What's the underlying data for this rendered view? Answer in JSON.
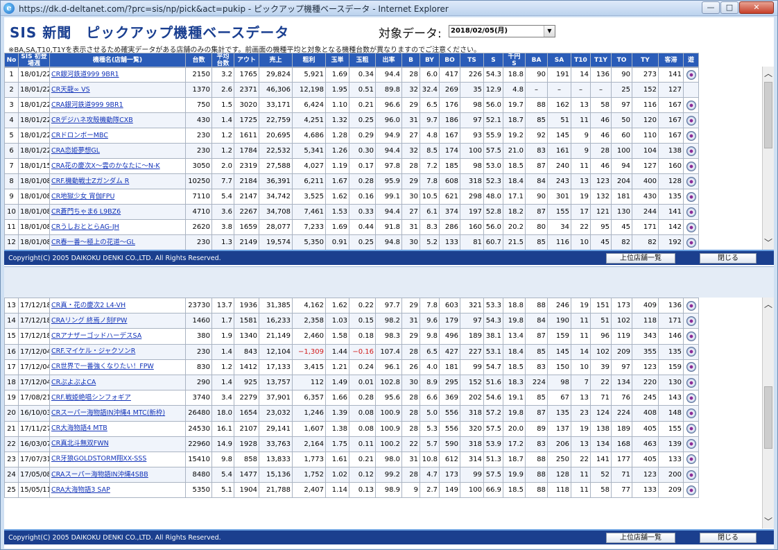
{
  "window": {
    "title": "https://dk.d-deltanet.com/?prc=sis/np/pick&act=pukip - ピックアップ機種ベースデータ - Internet Explorer",
    "min_glyph": "—",
    "max_glyph": "□",
    "close_glyph": "✕",
    "ie_glyph": "e"
  },
  "header": {
    "title": "SIS 新聞　ピックアップ機種ベースデータ",
    "target_label": "対象データ:",
    "date_value": "2018/02/05(月)",
    "note": "※BA,SA,T10,T1Yを表示させるため確実データがある店舗のみの集計です。前画面の機種平均と対象となる機種台数が異なりますのでご注意ください。"
  },
  "columns": [
    "No",
    "SIS 初登場週",
    "機種名(店舗一覧)",
    "台数",
    "平均 台数",
    "アウト",
    "売上",
    "粗利",
    "玉単",
    "玉粗",
    "出率",
    "B",
    "BY",
    "BO",
    "TS",
    "S",
    "千円 S",
    "BA",
    "SA",
    "T10",
    "T1Y",
    "TO",
    "TY",
    "客滞",
    "遊"
  ],
  "rows": [
    [
      "1",
      "18/01/22",
      "CR銀河鉄道999 9BR1",
      "2150",
      "3.2",
      "1765",
      "29,824",
      "5,921",
      "1.69",
      "0.34",
      "94.4",
      "28",
      "6.0",
      "417",
      "226",
      "54.3",
      "18.8",
      "90",
      "191",
      "14",
      "136",
      "90",
      "273",
      "141"
    ],
    [
      "2",
      "18/01/22",
      "CR天龍∞ VS",
      "1370",
      "2.6",
      "2371",
      "46,306",
      "12,198",
      "1.95",
      "0.51",
      "89.8",
      "32",
      "32.4",
      "269",
      "35",
      "12.9",
      "4.8",
      "–",
      "–",
      "–",
      "–",
      "25",
      "152",
      "127"
    ],
    [
      "3",
      "18/01/22",
      "CRA銀河鉄道999 9BR1",
      "750",
      "1.5",
      "3020",
      "33,171",
      "6,424",
      "1.10",
      "0.21",
      "96.6",
      "29",
      "6.5",
      "176",
      "98",
      "56.0",
      "19.7",
      "88",
      "162",
      "13",
      "58",
      "97",
      "116",
      "167"
    ],
    [
      "4",
      "18/01/22",
      "CRデジハネ攻殻機動隊CXB",
      "430",
      "1.4",
      "1725",
      "22,759",
      "4,251",
      "1.32",
      "0.25",
      "96.0",
      "31",
      "9.7",
      "186",
      "97",
      "52.1",
      "18.7",
      "85",
      "51",
      "11",
      "46",
      "50",
      "120",
      "167"
    ],
    [
      "5",
      "18/01/22",
      "CRドロンボーMBC",
      "230",
      "1.2",
      "1611",
      "20,695",
      "4,686",
      "1.28",
      "0.29",
      "94.9",
      "27",
      "4.8",
      "167",
      "93",
      "55.9",
      "19.2",
      "92",
      "145",
      "9",
      "46",
      "60",
      "110",
      "167"
    ],
    [
      "6",
      "18/01/22",
      "CRA恋姫夢想GL",
      "230",
      "1.2",
      "1784",
      "22,532",
      "5,341",
      "1.26",
      "0.30",
      "94.4",
      "32",
      "8.5",
      "174",
      "100",
      "57.5",
      "21.0",
      "83",
      "161",
      "9",
      "28",
      "100",
      "104",
      "138"
    ],
    [
      "7",
      "18/01/15",
      "CRA花の慶次X〜雲のかなたに〜N-K",
      "3050",
      "2.0",
      "2319",
      "27,588",
      "4,027",
      "1.19",
      "0.17",
      "97.8",
      "28",
      "7.2",
      "185",
      "98",
      "53.0",
      "18.5",
      "87",
      "240",
      "11",
      "46",
      "94",
      "127",
      "160"
    ],
    [
      "8",
      "18/01/08",
      "CRF.機動戦士Zガンダム R",
      "10250",
      "7.7",
      "2184",
      "36,391",
      "6,211",
      "1.67",
      "0.28",
      "95.9",
      "29",
      "7.8",
      "608",
      "318",
      "52.3",
      "18.4",
      "84",
      "243",
      "13",
      "123",
      "204",
      "400",
      "128"
    ],
    [
      "9",
      "18/01/08",
      "CR地獄少女 宵伽FPU",
      "7110",
      "5.4",
      "2147",
      "34,742",
      "3,525",
      "1.62",
      "0.16",
      "99.1",
      "30",
      "10.5",
      "621",
      "298",
      "48.0",
      "17.1",
      "90",
      "301",
      "19",
      "132",
      "181",
      "430",
      "135"
    ],
    [
      "10",
      "18/01/08",
      "CR蒼門ちゃま6 L9BZ6",
      "4710",
      "3.6",
      "2267",
      "34,708",
      "7,461",
      "1.53",
      "0.33",
      "94.4",
      "27",
      "6.1",
      "374",
      "197",
      "52.8",
      "18.2",
      "87",
      "155",
      "17",
      "121",
      "130",
      "244",
      "141"
    ],
    [
      "11",
      "18/01/08",
      "CRうしおととらAG-JH",
      "2620",
      "3.8",
      "1659",
      "28,077",
      "7,233",
      "1.69",
      "0.44",
      "91.8",
      "31",
      "8.3",
      "286",
      "160",
      "56.0",
      "20.2",
      "80",
      "34",
      "22",
      "95",
      "45",
      "171",
      "142"
    ],
    [
      "12",
      "18/01/08",
      "CR春一番〜極上の花道〜GL",
      "230",
      "1.3",
      "2149",
      "19,574",
      "5,350",
      "0.91",
      "0.25",
      "94.8",
      "30",
      "5.2",
      "133",
      "81",
      "60.7",
      "21.5",
      "85",
      "116",
      "10",
      "45",
      "82",
      "82",
      "192"
    ]
  ],
  "rows2": [
    [
      "13",
      "17/12/18",
      "CR真・花の慶次2 L4-VH",
      "23730",
      "13.7",
      "1936",
      "31,385",
      "4,162",
      "1.62",
      "0.22",
      "97.7",
      "29",
      "7.8",
      "603",
      "321",
      "53.3",
      "18.8",
      "88",
      "246",
      "19",
      "151",
      "173",
      "409",
      "136"
    ],
    [
      "14",
      "17/12/18",
      "CRAリング 終焉ノ刻FPW",
      "1460",
      "1.7",
      "1581",
      "16,233",
      "2,358",
      "1.03",
      "0.15",
      "98.2",
      "31",
      "9.6",
      "179",
      "97",
      "54.3",
      "19.8",
      "84",
      "190",
      "11",
      "51",
      "102",
      "118",
      "171"
    ],
    [
      "15",
      "17/12/18",
      "CRアナザーゴッドハーデスSA",
      "380",
      "1.9",
      "1340",
      "21,149",
      "2,460",
      "1.58",
      "0.18",
      "98.3",
      "29",
      "9.8",
      "496",
      "189",
      "38.1",
      "13.4",
      "87",
      "159",
      "11",
      "96",
      "119",
      "343",
      "146"
    ],
    [
      "16",
      "17/12/04",
      "CRF.マイケル・ジャクソンR",
      "230",
      "1.4",
      "843",
      "12,104",
      "−1,309",
      "1.44",
      "−0.16",
      "107.4",
      "28",
      "6.5",
      "427",
      "227",
      "53.1",
      "18.4",
      "85",
      "145",
      "14",
      "102",
      "209",
      "355",
      "135"
    ],
    [
      "17",
      "17/12/04",
      "CR世界で一番強くなりたい！FPW",
      "830",
      "1.2",
      "1412",
      "17,133",
      "3,415",
      "1.21",
      "0.24",
      "96.1",
      "26",
      "4.0",
      "181",
      "99",
      "54.7",
      "18.5",
      "83",
      "150",
      "10",
      "39",
      "97",
      "123",
      "159"
    ],
    [
      "18",
      "17/12/04",
      "CRぷよぷよCA",
      "290",
      "1.4",
      "925",
      "13,757",
      "112",
      "1.49",
      "0.01",
      "102.8",
      "30",
      "8.9",
      "295",
      "152",
      "51.6",
      "18.3",
      "224",
      "98",
      "7",
      "22",
      "134",
      "220",
      "130"
    ],
    [
      "19",
      "17/08/21",
      "CRF.戦姫絶唱シンフォギア",
      "3740",
      "3.4",
      "2279",
      "37,901",
      "6,357",
      "1.66",
      "0.28",
      "95.6",
      "28",
      "6.6",
      "369",
      "202",
      "54.6",
      "19.1",
      "85",
      "67",
      "13",
      "71",
      "76",
      "245",
      "143"
    ],
    [
      "20",
      "16/10/03",
      "CRスーパー海物語IN沖縄4 MTC(新枠)",
      "26480",
      "18.0",
      "1654",
      "23,032",
      "1,246",
      "1.39",
      "0.08",
      "100.9",
      "28",
      "5.0",
      "556",
      "318",
      "57.2",
      "19.8",
      "87",
      "135",
      "23",
      "124",
      "224",
      "408",
      "148"
    ],
    [
      "21",
      "17/11/27",
      "CR大海物語4 MTB",
      "24530",
      "16.1",
      "2107",
      "29,141",
      "1,607",
      "1.38",
      "0.08",
      "100.9",
      "28",
      "5.3",
      "556",
      "320",
      "57.5",
      "20.0",
      "89",
      "137",
      "19",
      "138",
      "189",
      "405",
      "155"
    ],
    [
      "22",
      "16/03/07",
      "CR真北斗無双FWN",
      "22960",
      "14.9",
      "1928",
      "33,763",
      "2,164",
      "1.75",
      "0.11",
      "100.2",
      "22",
      "5.7",
      "590",
      "318",
      "53.9",
      "17.2",
      "83",
      "206",
      "13",
      "134",
      "168",
      "463",
      "139"
    ],
    [
      "23",
      "17/07/31",
      "CR牙狼GOLDSTORM翔XX-SSS",
      "15410",
      "9.8",
      "858",
      "13,833",
      "1,773",
      "1.61",
      "0.21",
      "98.0",
      "31",
      "10.8",
      "612",
      "314",
      "51.3",
      "18.7",
      "88",
      "250",
      "22",
      "141",
      "177",
      "405",
      "133"
    ],
    [
      "24",
      "17/05/08",
      "CRAスーパー海物語IN沖縄4SBB",
      "8480",
      "5.4",
      "1477",
      "15,136",
      "1,752",
      "1.02",
      "0.12",
      "99.2",
      "28",
      "4.7",
      "173",
      "99",
      "57.5",
      "19.9",
      "88",
      "128",
      "11",
      "52",
      "71",
      "123",
      "200"
    ],
    [
      "25",
      "15/05/11",
      "CRA大海物語3 SAP",
      "5350",
      "5.1",
      "1904",
      "21,788",
      "2,407",
      "1.14",
      "0.13",
      "98.9",
      "9",
      "2.7",
      "149",
      "100",
      "66.9",
      "18.5",
      "88",
      "118",
      "11",
      "58",
      "77",
      "133",
      "209"
    ]
  ],
  "footer": {
    "copyright": "Copyright(C) 2005 DAIKOKU DENKI CO.,LTD. All Rights Reserved.",
    "store_list_button": "上位店舗一覧",
    "close_button": "閉じる"
  },
  "scroll": {
    "up": "︿",
    "down": "﹀"
  },
  "colors": {
    "header_bg": "#2a5cb8",
    "footer_bg": "#1b3f8e",
    "negative": "#d11a1a",
    "link": "#1233b8"
  }
}
